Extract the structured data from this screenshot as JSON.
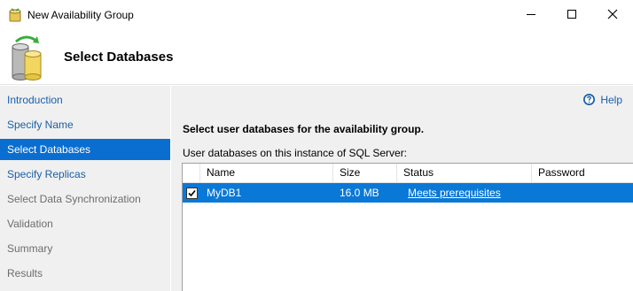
{
  "window": {
    "title": "New Availability Group"
  },
  "header": {
    "title": "Select Databases"
  },
  "nav": {
    "items": [
      {
        "label": "Introduction",
        "state": "link"
      },
      {
        "label": "Specify Name",
        "state": "link"
      },
      {
        "label": "Select Databases",
        "state": "selected"
      },
      {
        "label": "Specify Replicas",
        "state": "link"
      },
      {
        "label": "Select Data Synchronization",
        "state": "disabled"
      },
      {
        "label": "Validation",
        "state": "disabled"
      },
      {
        "label": "Summary",
        "state": "disabled"
      },
      {
        "label": "Results",
        "state": "disabled"
      }
    ]
  },
  "content": {
    "help_label": "Help",
    "heading": "Select user databases for the availability group.",
    "list_label": "User databases on this instance of SQL Server:",
    "columns": [
      "Name",
      "Size",
      "Status",
      "Password"
    ],
    "rows": [
      {
        "checked": true,
        "name": "MyDB1",
        "size": "16.0 MB",
        "status": "Meets prerequisites",
        "password": ""
      }
    ]
  },
  "colors": {
    "selection": "#0a78d7",
    "nav_selected": "#0a6ed1",
    "link": "#1a5fa8",
    "panel_bg": "#f0f0f0"
  }
}
